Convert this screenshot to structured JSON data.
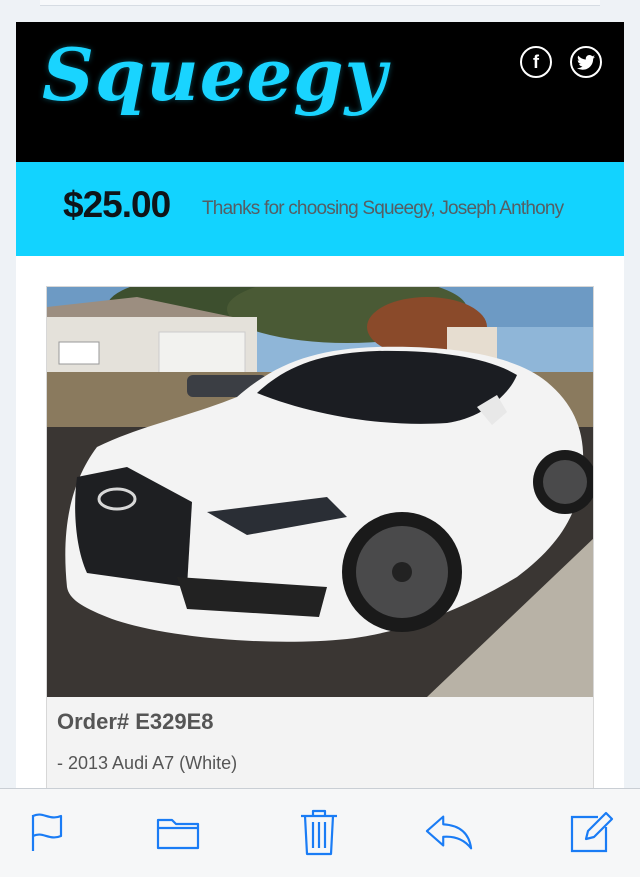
{
  "header": {
    "logo_text": "Squeegy",
    "social": [
      "facebook-icon",
      "twitter-icon"
    ],
    "logo_color": "#19d4ff"
  },
  "banner": {
    "amount": "$25.00",
    "message": "Thanks for choosing Squeegy, Joseph Anthony",
    "color": "#12d3ff"
  },
  "order": {
    "number_label": "Order# E329E8",
    "vehicle": "- 2013 Audi A7 (White)"
  },
  "toolbar": {
    "icons": [
      "flag-icon",
      "folder-icon",
      "trash-icon",
      "reply-icon",
      "compose-icon"
    ],
    "color": "#1a7cf5"
  }
}
